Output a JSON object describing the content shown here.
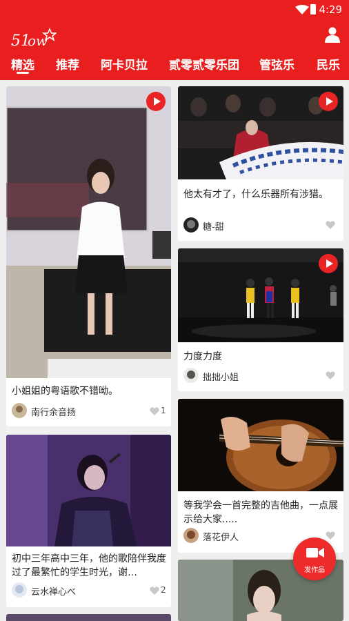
{
  "status_bar": {
    "time": "4:29"
  },
  "header": {
    "logo_text": "51show"
  },
  "tabs": [
    {
      "label": "精选"
    },
    {
      "label": "推荐"
    },
    {
      "label": "阿卡贝拉"
    },
    {
      "label": "贰零贰零乐团"
    },
    {
      "label": "管弦乐"
    },
    {
      "label": "民乐"
    }
  ],
  "feed": {
    "left": [
      {
        "title": "小姐姐的粤语歌不错呦。",
        "author": "南行余音扬",
        "likes": "1"
      },
      {
        "title": "初中三年高中三年，他的歌陪伴我度过了最繁忙的学生时光，谢…",
        "author": "云水禅心べ",
        "likes": "2"
      }
    ],
    "right": [
      {
        "title": "他太有才了，什么乐器所有涉猎。",
        "author": "糖-甜"
      },
      {
        "title": "力度力度",
        "author": "拙拙小姐"
      },
      {
        "title": "等我学会一首完整的吉他曲，一点展示给大家.....",
        "author": "落花伊人"
      }
    ]
  },
  "fab": {
    "label": "发作品"
  },
  "colors": {
    "accent": "#e91e1e",
    "background": "#efefef"
  }
}
